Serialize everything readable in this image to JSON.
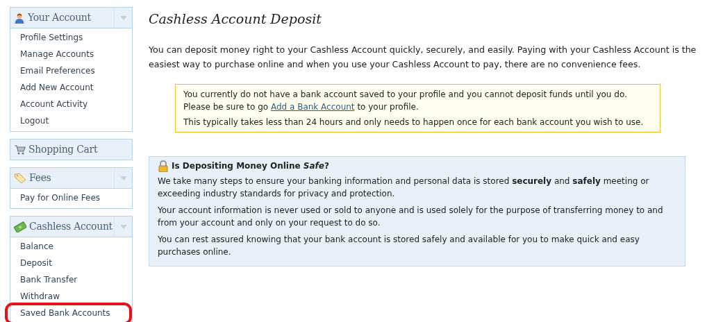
{
  "sidebar": {
    "groups": [
      {
        "title": "Your Account",
        "kind": "person",
        "collapsible": true,
        "items": [
          {
            "label": "Profile Settings",
            "highlighted": false
          },
          {
            "label": "Manage Accounts",
            "highlighted": false
          },
          {
            "label": "Email Preferences",
            "highlighted": false
          },
          {
            "label": "Add New Account",
            "highlighted": false
          },
          {
            "label": "Account Activity",
            "highlighted": false
          },
          {
            "label": "Logout",
            "highlighted": false
          }
        ]
      },
      {
        "title": "Shopping Cart",
        "kind": "cart",
        "collapsible": false
      },
      {
        "title": "Fees",
        "kind": "tag",
        "collapsible": true,
        "items": [
          {
            "label": "Pay for Online Fees",
            "highlighted": false
          }
        ]
      },
      {
        "title": "Cashless Account",
        "kind": "money",
        "collapsible": true,
        "items": [
          {
            "label": "Balance",
            "highlighted": false
          },
          {
            "label": "Deposit",
            "highlighted": false
          },
          {
            "label": "Bank Transfer",
            "highlighted": false
          },
          {
            "label": "Withdraw",
            "highlighted": false
          },
          {
            "label": "Saved Bank Accounts",
            "highlighted": true
          }
        ]
      }
    ]
  },
  "page": {
    "title": "Cashless Account Deposit",
    "intro": "You can deposit money right to your Cashless Account quickly, securely, and easily. Paying with your Cashless Account is the easiest way to purchase online and when you use your Cashless Account to pay, there are no convenience fees.",
    "warning": {
      "paragraphs": [
        {
          "lines": [
            {
              "text": "You currently do not have a bank account saved to your profile and you cannot deposit funds until you do."
            },
            {
              "text": "Please be sure to go ",
              "link": "Add a Bank Account",
              "after": " to your profile."
            }
          ]
        },
        {
          "lines": [
            {
              "text": "This typically takes less than 24 hours and only needs to happen once for each bank account you wish to use."
            }
          ]
        }
      ]
    },
    "info": {
      "title": "Is Depositing Money Online *Safe*?",
      "paragraphs": [
        "We take many steps to ensure your banking information and personal data is stored **securely** and **safely** meeting or exceeding industry standards for privacy and protection.",
        "Your account information is never used or sold to anyone and is used solely for the purpose of transferring money to and from your account and only on your request to do so.",
        "You can rest assured knowing that your bank account is stored safely and available for you to make quick and easy purchases online."
      ]
    }
  }
}
